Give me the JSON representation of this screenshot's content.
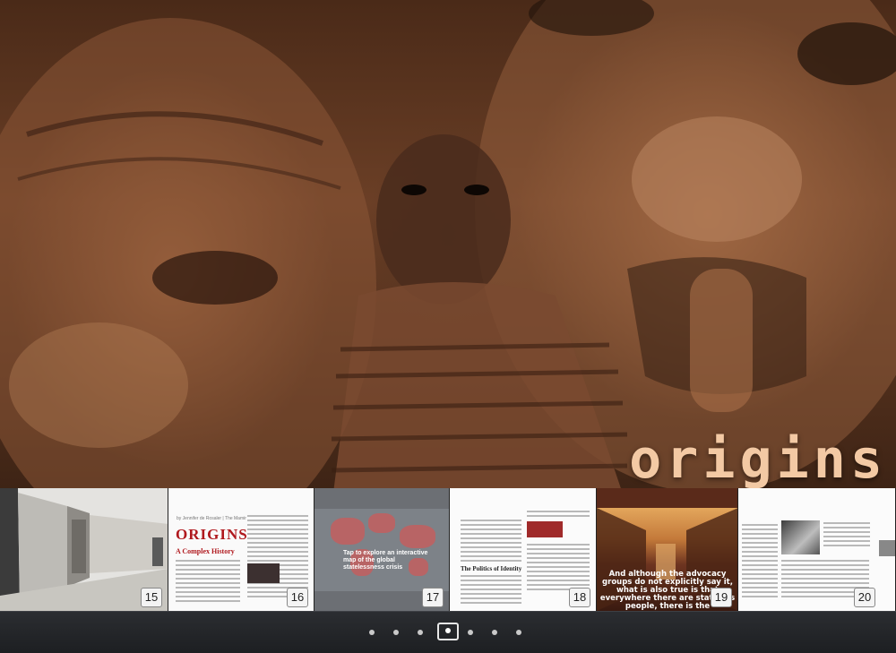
{
  "hero": {
    "title": "origins"
  },
  "thumbnails": [
    {
      "page": "15"
    },
    {
      "page": "16",
      "byline": "by Jennifer de Rosaler | The Mamir",
      "title": "ORIGINS",
      "subtitle": "A Complex History"
    },
    {
      "page": "17",
      "caption": "Tap to explore an interactive map of the global statelessness crisis"
    },
    {
      "page": "18",
      "heading": "The Politics of Identity"
    },
    {
      "page": "19",
      "quote": "And although the advocacy groups do not explicitly say it, what is also true is that everywhere there are stateless people, there is the"
    },
    {
      "page": "20"
    }
  ],
  "pager": {
    "count": 7,
    "active_index": 3
  },
  "colors": {
    "title_accent": "#f3c9a4",
    "headline_red": "#b0191e",
    "bar_bg": "#1d1f22"
  }
}
